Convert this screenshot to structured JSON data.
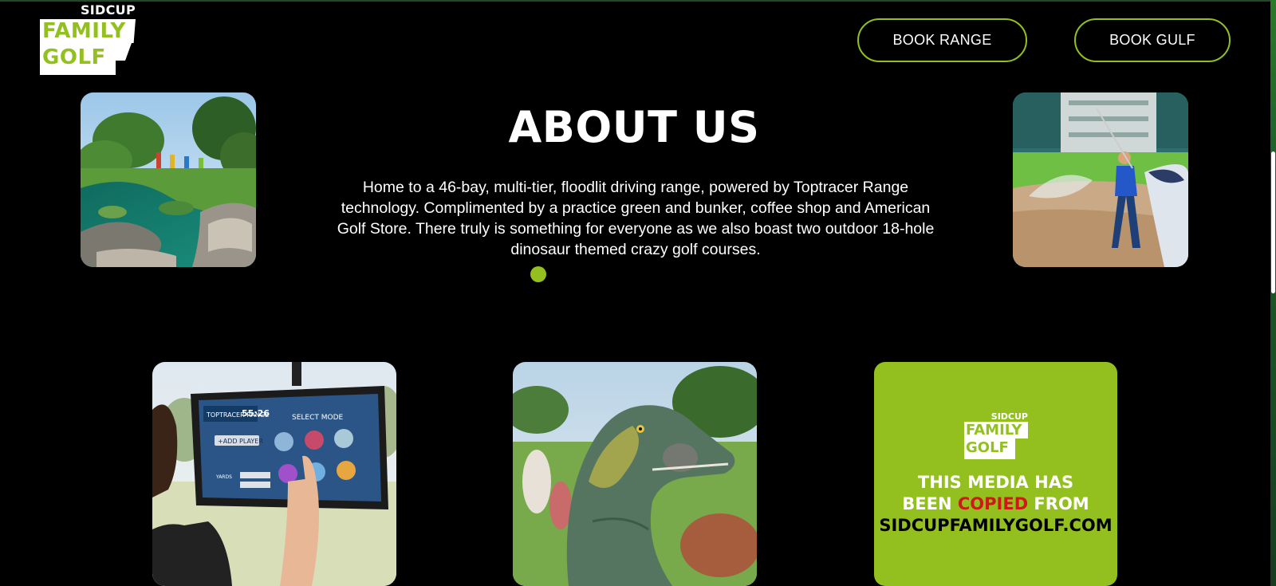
{
  "header": {
    "logo": {
      "top": "SIDCUP",
      "line1": "FAMILY",
      "line2": "GOLF"
    },
    "buttons": {
      "range": "BOOK RANGE",
      "gulf": "BOOK GULF"
    }
  },
  "about": {
    "title": "ABOUT US",
    "text": "Home to a 46-bay, multi-tier, floodlit driving range, powered by Toptracer Range technology. Complimented by a practice green and bunker, coffee shop and American Golf Store. There truly is something for everyone as we also boast two outdoor 18-hole dinosaur themed crazy golf courses."
  },
  "screen_photo": {
    "brand": "TOPTRACER RANGE",
    "time": "55:26",
    "select_mode": "SELECT MODE",
    "add_player": "+ADD PLAYER",
    "units": "YARDS"
  },
  "media_card": {
    "logo": {
      "top": "SIDCUP",
      "line1": "FAMILY",
      "line2": "GOLF"
    },
    "line1": "THIS MEDIA HAS",
    "line2_a": "BEEN ",
    "line2_red": "COPIED",
    "line2_b": " FROM",
    "line3": "SIDCUPFAMILYGOLF.COM"
  },
  "colors": {
    "accent": "#93c01f",
    "background": "#000000",
    "warning": "#d01818"
  }
}
